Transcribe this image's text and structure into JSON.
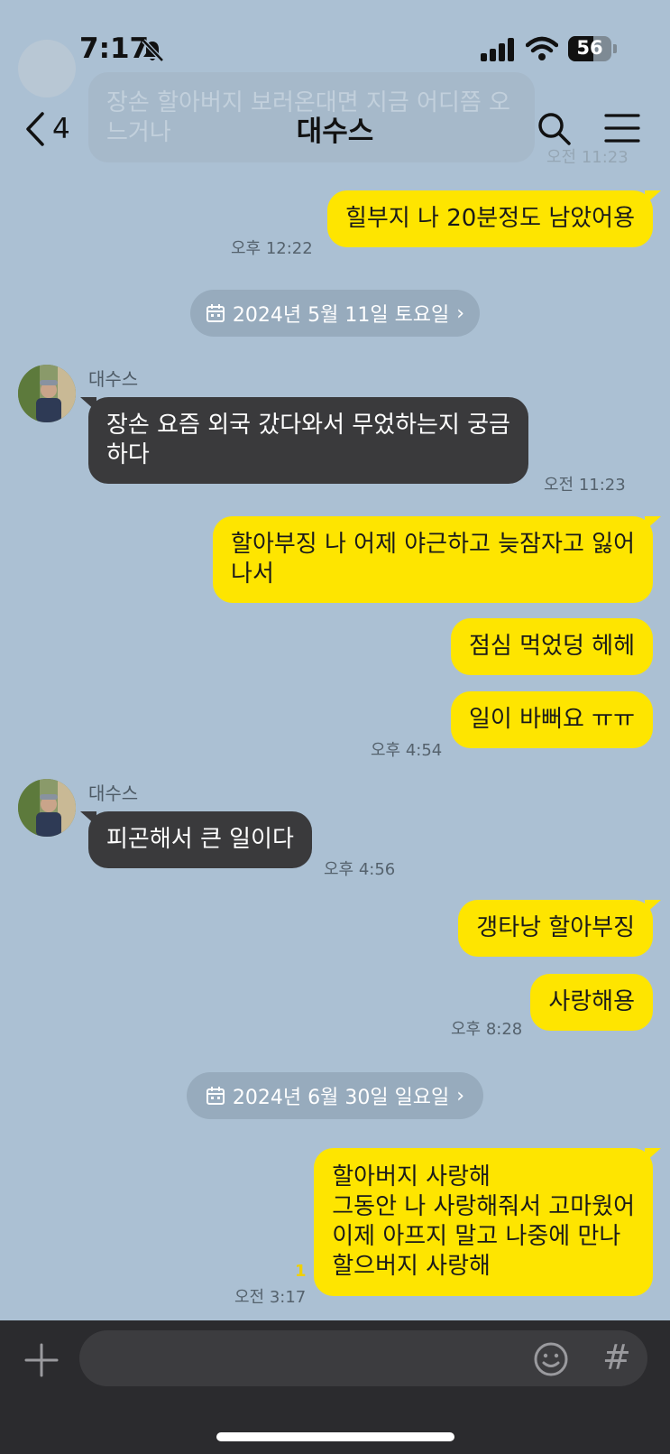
{
  "status_bar": {
    "time": "7:17",
    "battery": "56",
    "icons": [
      "bell-slash-icon",
      "signal-icon",
      "wifi-icon",
      "battery-icon"
    ]
  },
  "header": {
    "back_count": "4",
    "title": "대수스",
    "icons": [
      "chevron-left-icon",
      "search-icon",
      "hamburger-menu-icon"
    ]
  },
  "ghost": {
    "lines": [
      "장손 할아버지 보러온대면 지금 어디쯤 오",
      "느거나"
    ],
    "time": "오전 11:23"
  },
  "messages": {
    "m1": {
      "text": "힐부지 나 20분정도 남았어용",
      "time": "오후 12:22"
    },
    "date1": "2024년 5월 11일 토요일",
    "sender": "대수스",
    "m2": {
      "lines": [
        "장손 요즘 외국 갔다와서 무었하는지 궁금",
        "하다"
      ],
      "time": "오전 11:23"
    },
    "m3": {
      "lines": [
        "할아부징 나 어제 야근하고 늦잠자고 잃어",
        "나서"
      ]
    },
    "m4": {
      "text": "점심 먹었덩 헤헤"
    },
    "m5": {
      "text": "일이 바뻐요 ㅠㅠ",
      "time": "오후 4:54"
    },
    "m6": {
      "text": "피곤해서 큰 일이다",
      "time": "오후 4:56"
    },
    "m7": {
      "text": "갱타낭 할아부징"
    },
    "m8": {
      "text": "사랑해용",
      "time": "오후 8:28"
    },
    "date2": "2024년 6월 30일 일요일",
    "m9": {
      "lines": [
        "할아버지 사랑해",
        "그동안 나 사랑해줘서 고마웠어",
        "이제 아프지 말고 나중에 만나",
        "할으버지 사랑해"
      ],
      "time": "오전 3:17",
      "unread": "1"
    }
  },
  "input": {
    "placeholder": "",
    "icons": [
      "plus-icon",
      "emoji-icon",
      "hash-icon"
    ]
  },
  "colors": {
    "background": "#abc0d3",
    "my_bubble": "#fee500",
    "their_bubble": "#3a3a3c",
    "input_bar": "#2b2b2e"
  }
}
